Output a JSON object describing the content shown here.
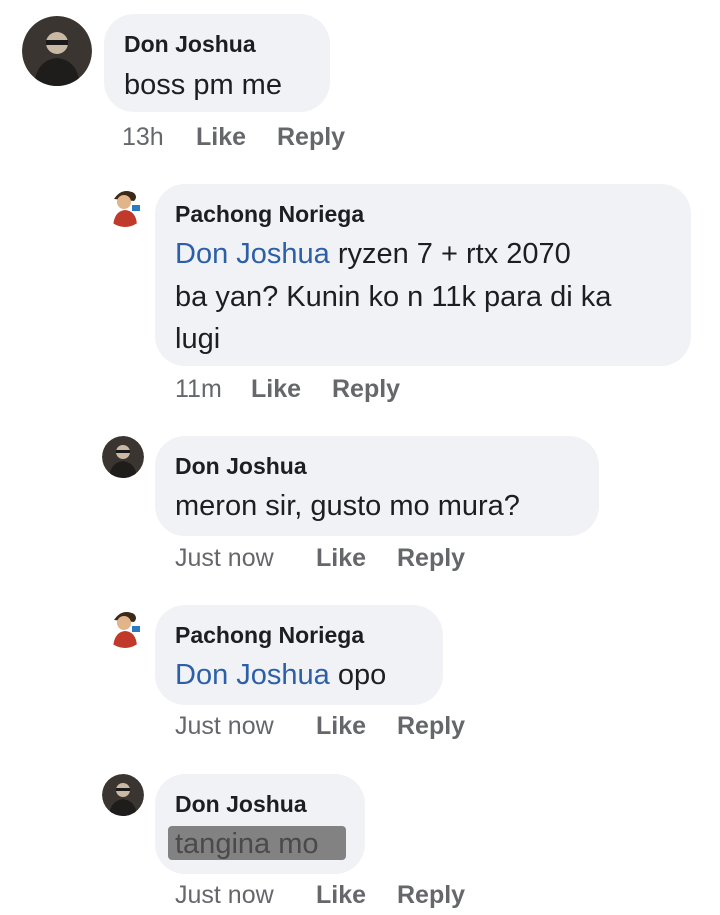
{
  "comments": [
    {
      "author": "Don Joshua",
      "text": "boss pm me",
      "time": "13h",
      "like": "Like",
      "reply": "Reply"
    },
    {
      "author": "Pachong Noriega",
      "mention": "Don Joshua",
      "line1": " ryzen 7 + rtx 2070",
      "line2": "ba yan? Kunin ko n 11k para di ka",
      "line3": "lugi",
      "time": "11m",
      "like": "Like",
      "reply": "Reply"
    },
    {
      "author": "Don Joshua",
      "text": "meron sir, gusto mo mura?",
      "time": "Just now",
      "like": "Like",
      "reply": "Reply"
    },
    {
      "author": "Pachong Noriega",
      "mention": "Don Joshua",
      "text": " opo",
      "time": "Just now",
      "like": "Like",
      "reply": "Reply"
    },
    {
      "author": "Don Joshua",
      "text": "tangina mo",
      "time": "Just now",
      "like": "Like",
      "reply": "Reply"
    }
  ],
  "colors": {
    "bubble": "#f0f2f5",
    "mention": "#2d5fa8",
    "meta": "#65676b"
  },
  "icons": {
    "don_avatar": "profile-photo-dark",
    "pachong_avatar": "profile-photo-cartoon"
  }
}
